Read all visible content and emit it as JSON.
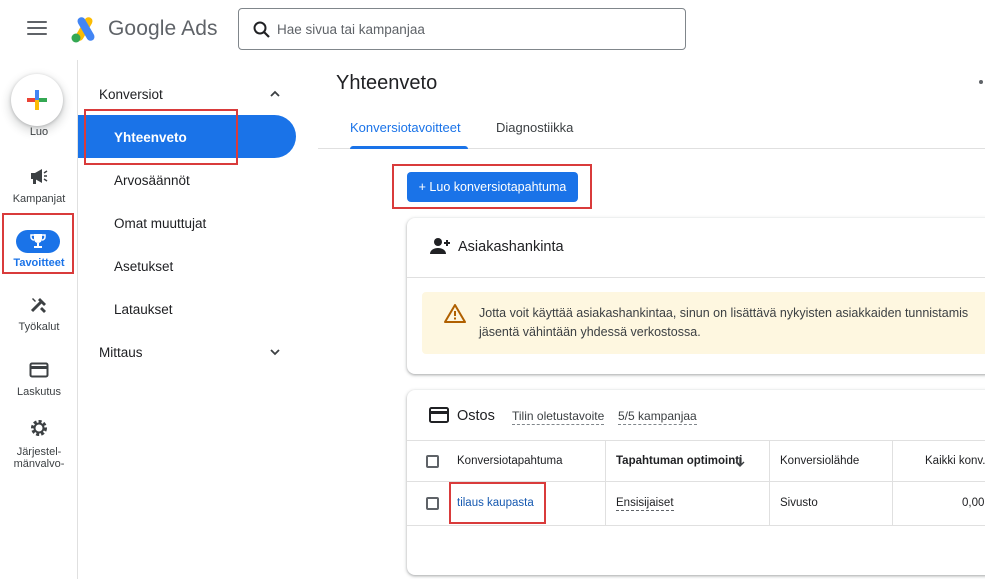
{
  "app": {
    "brand": "Google Ads"
  },
  "search": {
    "placeholder": "Hae sivua tai kampanjaa"
  },
  "rail": {
    "create_label": "Luo",
    "items": [
      {
        "label": "Kampanjat",
        "icon": "megaphone-icon"
      },
      {
        "label": "Tavoitteet",
        "icon": "trophy-icon",
        "active": true
      },
      {
        "label": "Työkalut",
        "icon": "tools-icon"
      },
      {
        "label": "Laskutus",
        "icon": "credit-card-icon"
      },
      {
        "label_line1": "Järjestel-",
        "label_line2": "mänvalvo-",
        "icon": "gear-icon"
      }
    ]
  },
  "subnav": {
    "section1": "Konversiot",
    "items": [
      "Yhteenveto",
      "Arvosäännöt",
      "Omat muuttujat",
      "Asetukset",
      "Lataukset"
    ],
    "active": "Yhteenveto",
    "section2": "Mittaus"
  },
  "main": {
    "title": "Yhteenveto",
    "tabs": [
      "Konversiotavoitteet",
      "Diagnostiikka"
    ],
    "create_button": "+ Luo konversiotapahtuma",
    "acquisition_card": {
      "title": "Asiakashankinta",
      "warning_line1": "Jotta voit käyttää asiakashankintaa, sinun on lisättävä nykyisten asiakkaiden tunnistamis",
      "warning_line2": "jäsentä vähintään yhdessä verkostossa."
    },
    "purchase_card": {
      "title": "Ostos",
      "meta1": "Tilin oletustavoite",
      "meta2": "5/5 kampanjaa",
      "columns": [
        "Konversiotapahtuma",
        "Tapahtuman optimointi",
        "Konversiolähde",
        "Kaikki konv."
      ],
      "rows": [
        {
          "event": "tilaus kaupasta",
          "optimization": "Ensisijaiset",
          "source": "Sivusto",
          "all_conv": "0,00"
        }
      ]
    }
  },
  "colors": {
    "accent": "#1a73e8",
    "highlight": "#d93b3b",
    "warning_bg": "#fef7e0"
  }
}
